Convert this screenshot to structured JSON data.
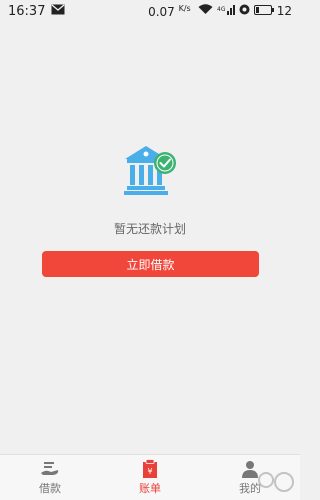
{
  "status_bar": {
    "time": "16:37",
    "net_speed": "0.07",
    "net_speed_unit": "K/s",
    "battery": "12"
  },
  "empty_state": {
    "illustration_icon": "bank-check-icon",
    "message": "暂无还款计划",
    "button_label": "立即借款"
  },
  "bottom_nav": {
    "items": [
      {
        "label": "借款",
        "icon": "borrow-icon",
        "active": false
      },
      {
        "label": "账单",
        "icon": "bill-icon",
        "active": true
      },
      {
        "label": "我的",
        "icon": "profile-icon",
        "active": false
      }
    ]
  },
  "colors": {
    "accent": "#e8413a",
    "button": "#f1463a",
    "bank_blue": "#4aaee8",
    "check_green": "#3cb371",
    "background": "#f0f0f0"
  }
}
